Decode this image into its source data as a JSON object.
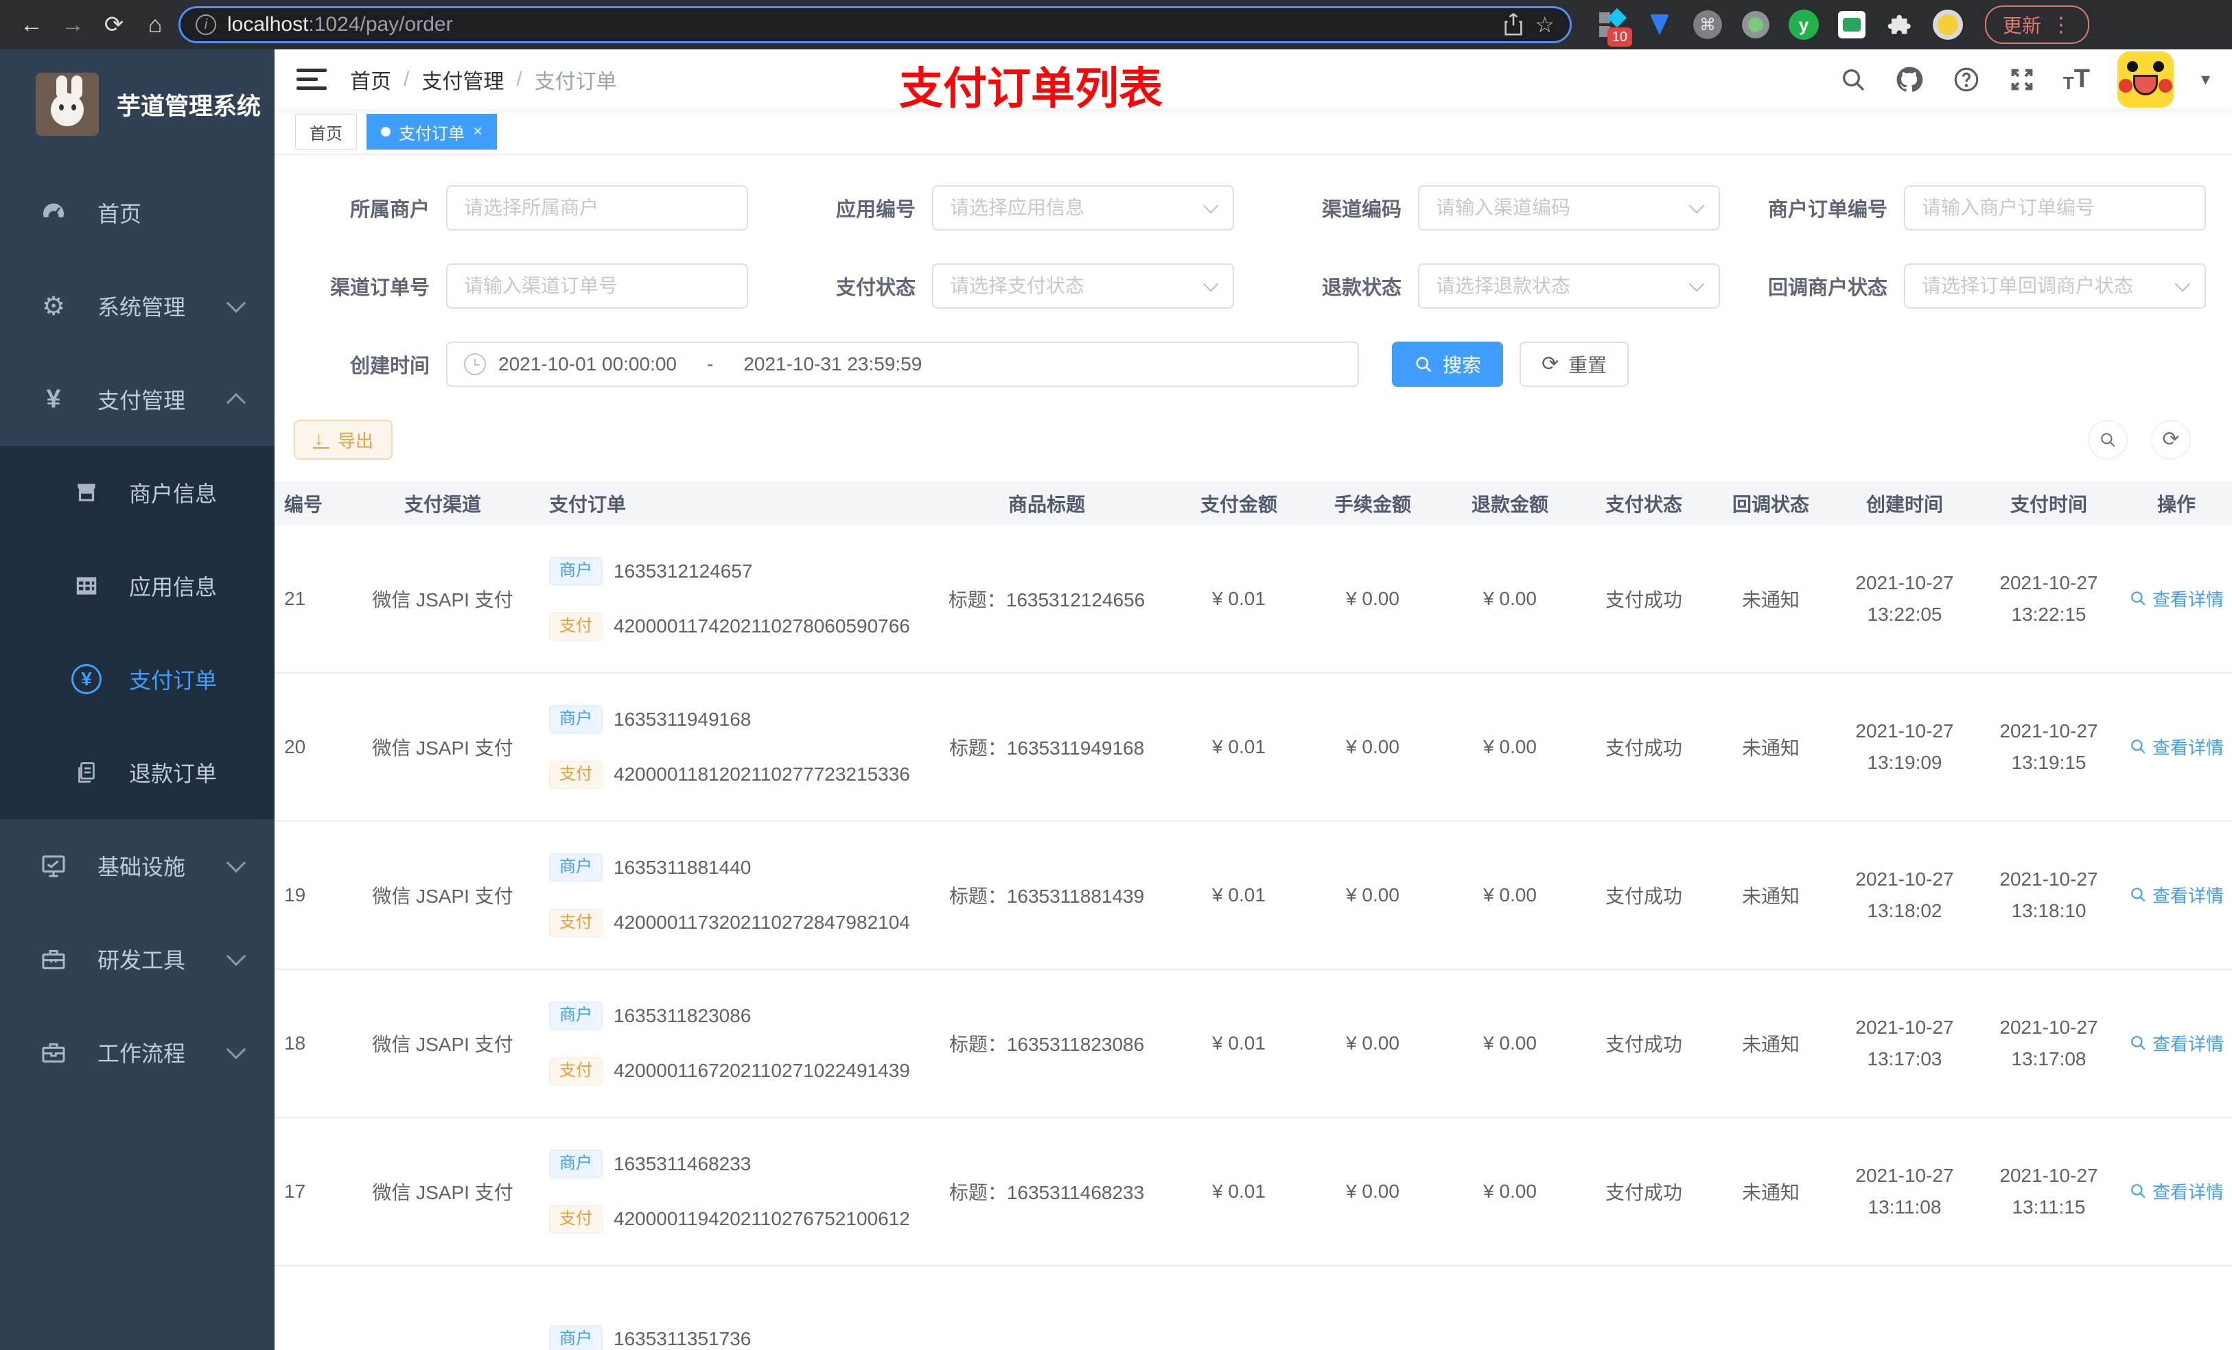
{
  "browser": {
    "url_host": "localhost",
    "url_rest": ":1024/pay/order",
    "ext_badge": "10",
    "update_label": "更新"
  },
  "icons": {
    "back": "←",
    "forward": "→",
    "reload": "⟳",
    "home": "⌂",
    "info": "i",
    "star": "☆",
    "kebab": "⋮",
    "caret": "▾",
    "cmd": "⌘",
    "y": "y",
    "puzzle": "",
    "question": "?",
    "gear": "⚙",
    "yen": "¥",
    "tt_small": "T",
    "tt_big": "T",
    "tab_close": "×",
    "refresh": "⟳"
  },
  "sidebar": {
    "title": "芋道管理系统",
    "items": [
      {
        "label": "首页"
      },
      {
        "label": "系统管理"
      },
      {
        "label": "支付管理"
      },
      {
        "label": "商户信息"
      },
      {
        "label": "应用信息"
      },
      {
        "label": "支付订单"
      },
      {
        "label": "退款订单"
      },
      {
        "label": "基础设施"
      },
      {
        "label": "研发工具"
      },
      {
        "label": "工作流程"
      }
    ]
  },
  "header": {
    "breadcrumb": {
      "0": "首页",
      "1": "支付管理",
      "2": "支付订单"
    },
    "annotation": "支付订单列表"
  },
  "tabs": {
    "0": {
      "label": "首页"
    },
    "1": {
      "label": "支付订单"
    }
  },
  "filters": {
    "row1": [
      {
        "label": "所属商户",
        "placeholder": "请选择所属商户"
      },
      {
        "label": "应用编号",
        "placeholder": "请选择应用信息"
      },
      {
        "label": "渠道编码",
        "placeholder": "请输入渠道编码"
      },
      {
        "label": "商户订单编号",
        "placeholder": "请输入商户订单编号"
      }
    ],
    "row2": [
      {
        "label": "渠道订单号",
        "placeholder": "请输入渠道订单号"
      },
      {
        "label": "支付状态",
        "placeholder": "请选择支付状态"
      },
      {
        "label": "退款状态",
        "placeholder": "请选择退款状态"
      },
      {
        "label": "回调商户状态",
        "placeholder": "请选择订单回调商户状态"
      }
    ],
    "time": {
      "label": "创建时间",
      "start": "2021-10-01 00:00:00",
      "sep": "-",
      "end": "2021-10-31 23:59:59"
    },
    "search_label": "搜索",
    "reset_label": "重置"
  },
  "toolbar": {
    "export_label": "导出"
  },
  "table": {
    "columns": [
      "编号",
      "支付渠道",
      "支付订单",
      "商品标题",
      "支付金额",
      "手续金额",
      "退款金额",
      "支付状态",
      "回调状态",
      "创建时间",
      "支付时间",
      "操作"
    ],
    "tag_merchant": "商户",
    "tag_pay": "支付",
    "action_label": "查看详情",
    "rows": [
      {
        "id": "21",
        "channel": "微信 JSAPI 支付",
        "mno": "1635312124657",
        "pno": "4200001174202110278060590766",
        "title": "标题：1635312124656",
        "amount": "¥ 0.01",
        "fee": "¥ 0.00",
        "refund": "¥ 0.00",
        "status": "支付成功",
        "notify": "未通知",
        "cdate": "2021-10-27",
        "ctime": "13:22:05",
        "pdate": "2021-10-27",
        "ptime": "13:22:15"
      },
      {
        "id": "20",
        "channel": "微信 JSAPI 支付",
        "mno": "1635311949168",
        "pno": "4200001181202110277723215336",
        "title": "标题：1635311949168",
        "amount": "¥ 0.01",
        "fee": "¥ 0.00",
        "refund": "¥ 0.00",
        "status": "支付成功",
        "notify": "未通知",
        "cdate": "2021-10-27",
        "ctime": "13:19:09",
        "pdate": "2021-10-27",
        "ptime": "13:19:15"
      },
      {
        "id": "19",
        "channel": "微信 JSAPI 支付",
        "mno": "1635311881440",
        "pno": "4200001173202110272847982104",
        "title": "标题：1635311881439",
        "amount": "¥ 0.01",
        "fee": "¥ 0.00",
        "refund": "¥ 0.00",
        "status": "支付成功",
        "notify": "未通知",
        "cdate": "2021-10-27",
        "ctime": "13:18:02",
        "pdate": "2021-10-27",
        "ptime": "13:18:10"
      },
      {
        "id": "18",
        "channel": "微信 JSAPI 支付",
        "mno": "1635311823086",
        "pno": "4200001167202110271022491439",
        "title": "标题：1635311823086",
        "amount": "¥ 0.01",
        "fee": "¥ 0.00",
        "refund": "¥ 0.00",
        "status": "支付成功",
        "notify": "未通知",
        "cdate": "2021-10-27",
        "ctime": "13:17:03",
        "pdate": "2021-10-27",
        "ptime": "13:17:08"
      },
      {
        "id": "17",
        "channel": "微信 JSAPI 支付",
        "mno": "1635311468233",
        "pno": "4200001194202110276752100612",
        "title": "标题：1635311468233",
        "amount": "¥ 0.01",
        "fee": "¥ 0.00",
        "refund": "¥ 0.00",
        "status": "支付成功",
        "notify": "未通知",
        "cdate": "2021-10-27",
        "ctime": "13:11:08",
        "pdate": "2021-10-27",
        "ptime": "13:11:15"
      }
    ],
    "partial_row": {
      "mno": "1635311351736"
    }
  }
}
